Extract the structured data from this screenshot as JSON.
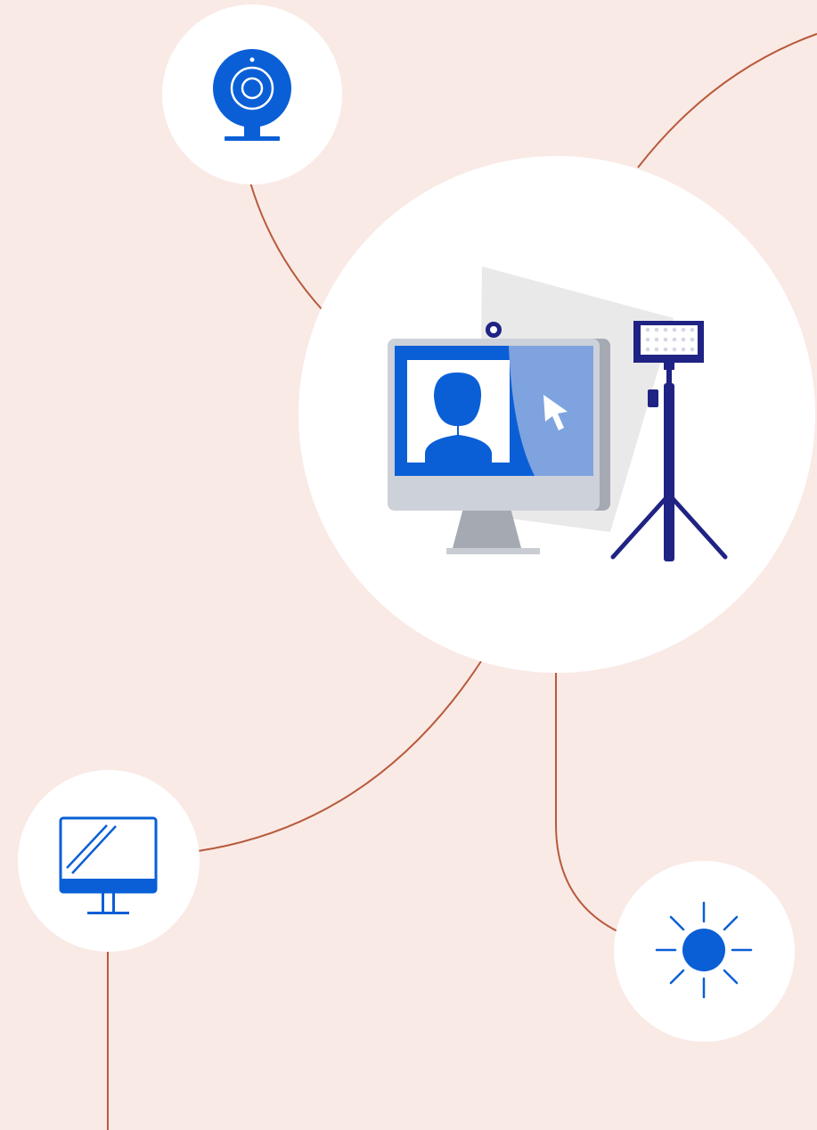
{
  "scene": {
    "background_color": "#f9eae6",
    "connector_color": "#b85a3a",
    "node_color": "#ffffff"
  },
  "palette": {
    "primary_blue": "#0a5fd6",
    "light_blue": "#7fa3df",
    "navy": "#1f2384",
    "monitor_gray": "#cdd1d9",
    "stand_gray": "#a5a9b2",
    "shadow_gray": "#e9e9e9"
  },
  "nodes": [
    {
      "id": "webcam",
      "icon": "webcam-icon"
    },
    {
      "id": "video-call-setup",
      "icon": "video-call-setup-illustration"
    },
    {
      "id": "monitor",
      "icon": "monitor-icon"
    },
    {
      "id": "light",
      "icon": "sun-icon"
    }
  ]
}
